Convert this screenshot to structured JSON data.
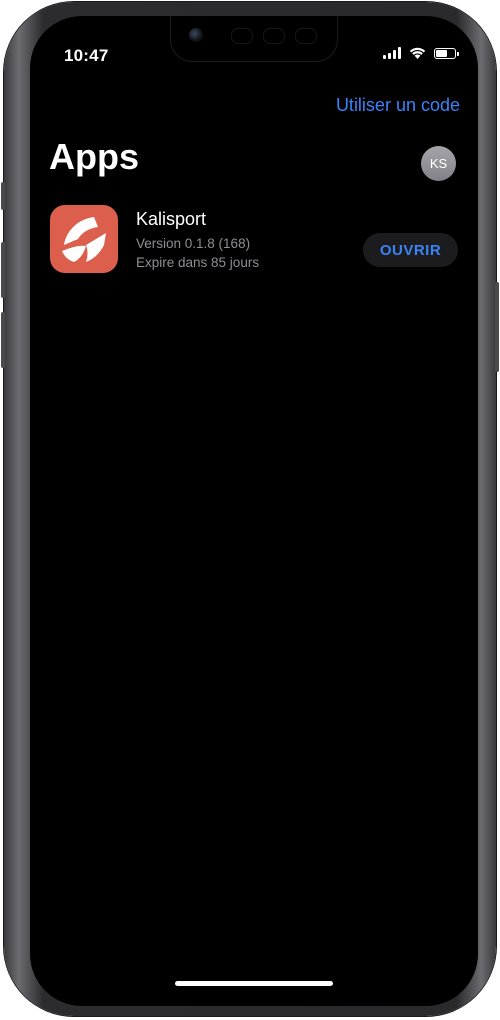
{
  "status_bar": {
    "time": "10:47",
    "icons": [
      "cellular-signal-icon",
      "wifi-icon",
      "battery-icon"
    ],
    "battery_level": 0.7
  },
  "header": {
    "use_code_link": "Utiliser un code",
    "title": "Apps",
    "avatar_initials": "KS"
  },
  "apps": [
    {
      "name": "Kalisport",
      "version": "Version 0.1.8 (168)",
      "expiry": "Expire dans 85 jours",
      "action_label": "OUVRIR",
      "icon": "kalisport-logo-icon",
      "icon_color": "#dc5f4d"
    }
  ],
  "colors": {
    "accent": "#3b82f6",
    "background": "#000000",
    "secondary_text": "#8e8e93",
    "button_background": "#1c1c1e"
  }
}
